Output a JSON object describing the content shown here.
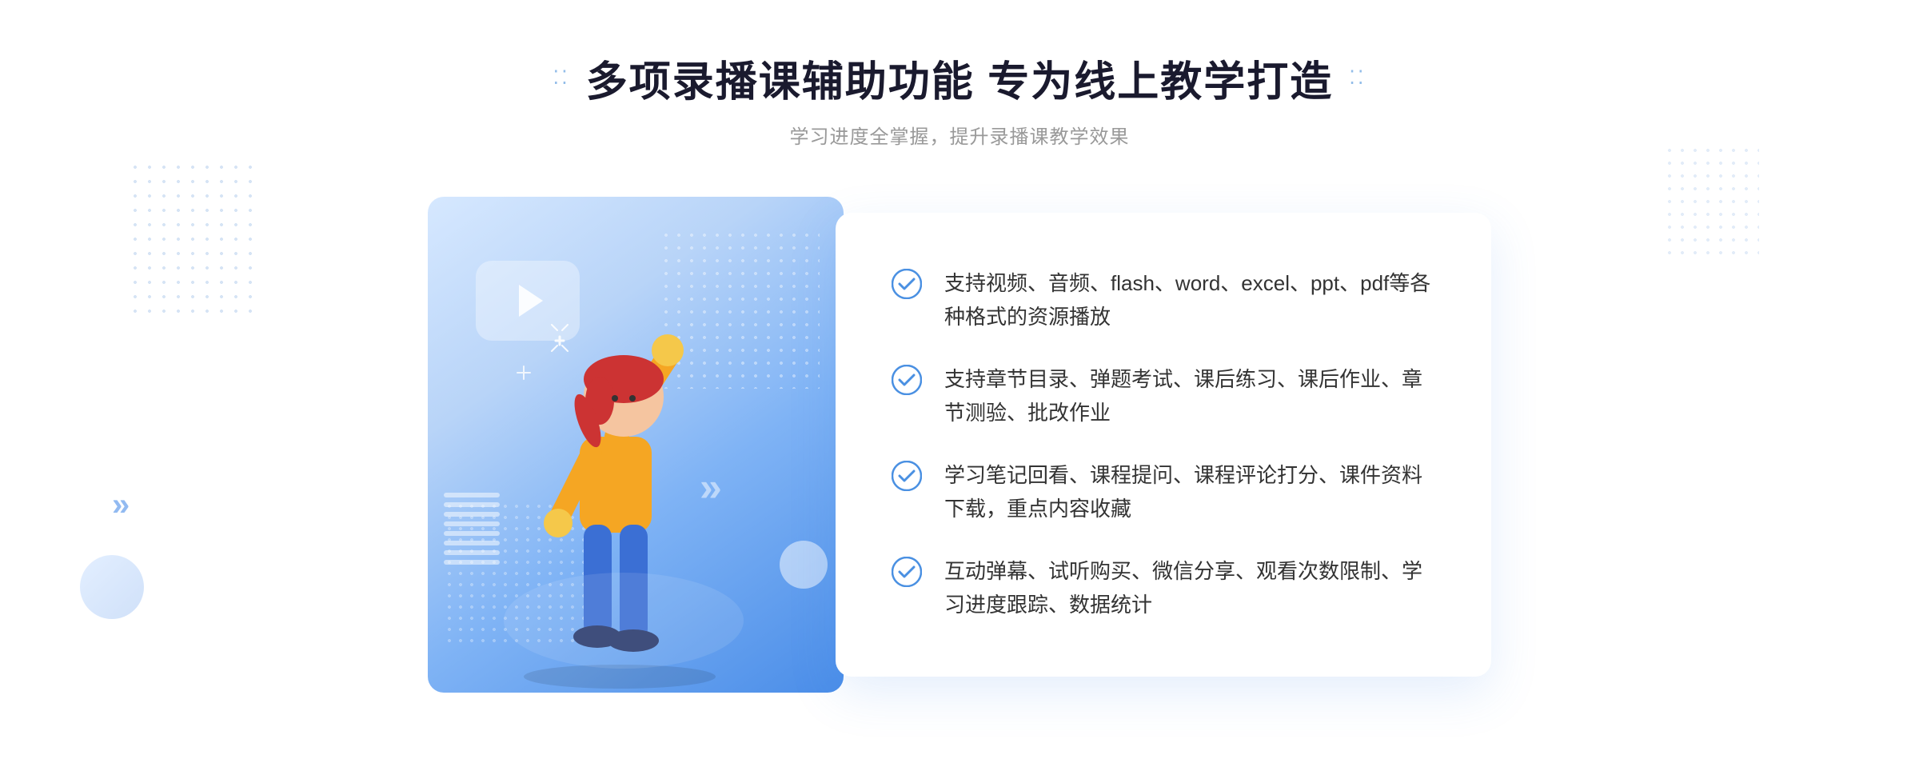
{
  "header": {
    "title": "多项录播课辅助功能 专为线上教学打造",
    "subtitle": "学习进度全掌握，提升录播课教学效果",
    "dots_left": "⁚⁚",
    "dots_right": "⁚⁚"
  },
  "features": [
    {
      "id": 1,
      "text": "支持视频、音频、flash、word、excel、ppt、pdf等各种格式的资源播放"
    },
    {
      "id": 2,
      "text": "支持章节目录、弹题考试、课后练习、课后作业、章节测验、批改作业"
    },
    {
      "id": 3,
      "text": "学习笔记回看、课程提问、课程评论打分、课件资料下载，重点内容收藏"
    },
    {
      "id": 4,
      "text": "互动弹幕、试听购买、微信分享、观看次数限制、学习进度跟踪、数据统计"
    }
  ],
  "decoration": {
    "chevrons": "»",
    "left_chevrons": "»"
  },
  "colors": {
    "accent_blue": "#4a8de8",
    "light_blue": "#5b9ef4",
    "check_color": "#4a90e2"
  }
}
